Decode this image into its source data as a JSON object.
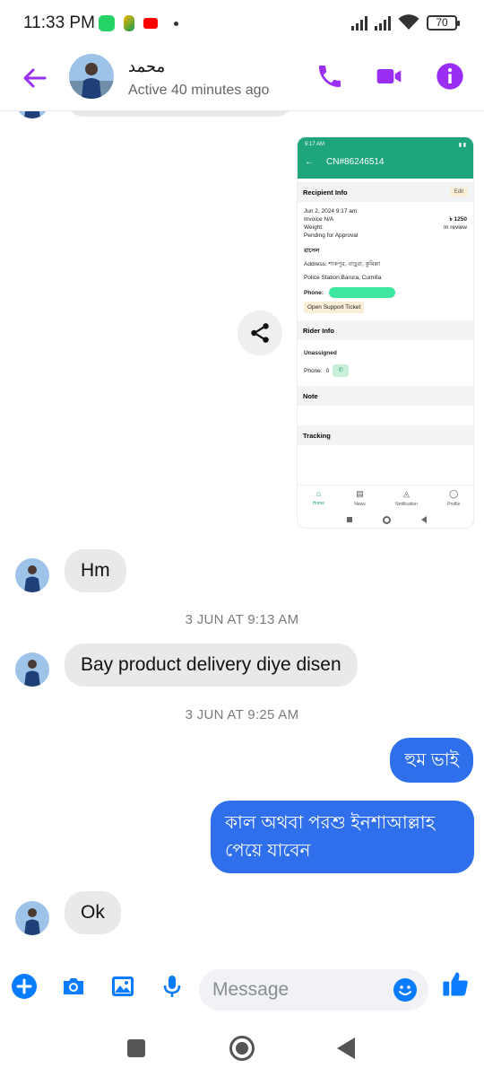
{
  "status_bar": {
    "time": "11:33 PM",
    "battery": "70"
  },
  "header": {
    "contact_name": "محمد",
    "active_status": "Active 40 minutes ago"
  },
  "shared_screenshot": {
    "status_time": "9:17 AM",
    "title": "CN#86246514",
    "recipient_info_label": "Recipient Info",
    "edit_label": "Edit",
    "date": "Jun 2, 2024 9:17 am",
    "invoice": "Invoice N/A",
    "amount": "৳ 1250",
    "weight": "Weight:",
    "review": "In review",
    "approval": "Pending for Approval",
    "name": "রাসেল",
    "address": "Address: শাকপুর, বাড়ুরা, কুমিল্লা",
    "police_station": "Police Station:Barura, Cumilla",
    "phone_label": "Phone:",
    "support_button": "Open Support Ticket",
    "rider_info_label": "Rider Info",
    "unassigned": "Unassigned",
    "rider_phone_label": "Phone:",
    "rider_phone_value": "0",
    "note_label": "Note",
    "tracking_label": "Tracking",
    "nav": [
      "Home",
      "News",
      "Notification",
      "Profile"
    ]
  },
  "messages": {
    "hm": "Hm",
    "ts1": "3 JUN AT 9:13 AM",
    "delivery": "Bay product delivery diye disen",
    "ts2": "3 JUN AT 9:25 AM",
    "out1": "হুম ভাই",
    "out2": "কাল অথবা পরশু ইনশাআল্লাহ পেয়ে যাবেন",
    "ok": "Ok"
  },
  "composer": {
    "placeholder": "Message"
  },
  "colors": {
    "accent": "#9b2ef5",
    "messenger_blue": "#2f6fec",
    "app_green": "#1fa57c"
  }
}
